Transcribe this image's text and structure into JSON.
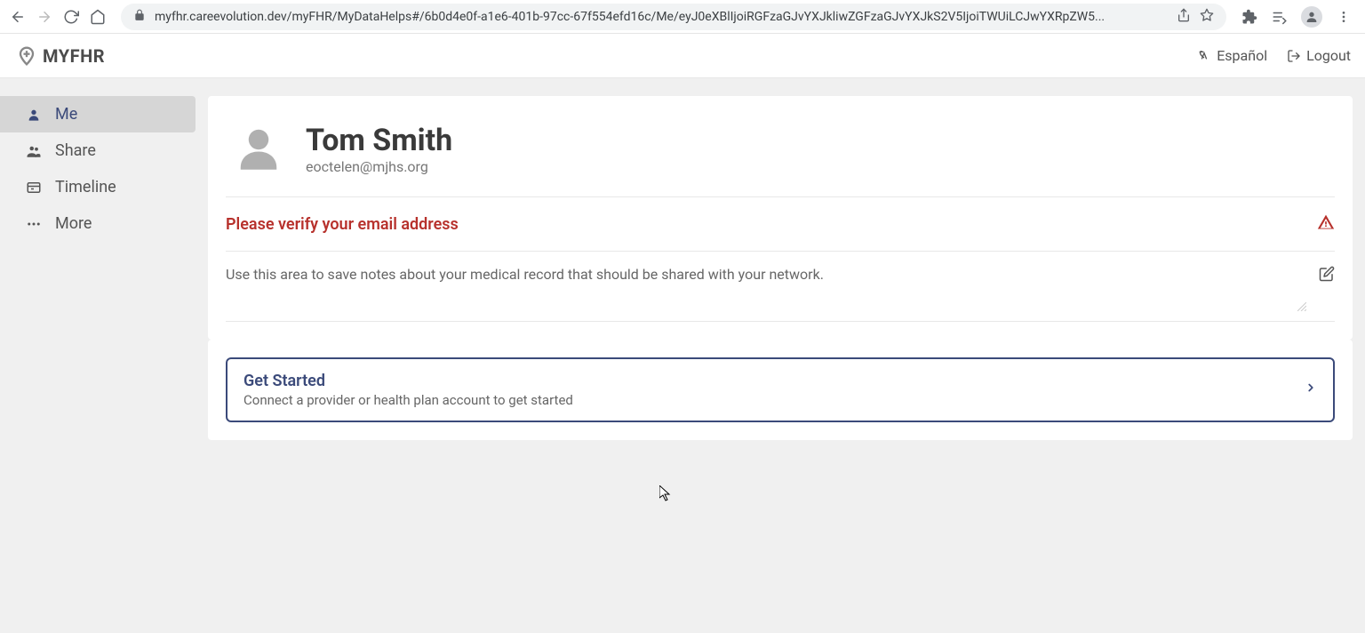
{
  "browser": {
    "url": "myfhr.careevolution.dev/myFHR/MyDataHelps#/6b0d4e0f-a1e6-401b-97cc-67f554efd16c/Me/eyJ0eXBlIjoiRGFzaGJvYXJkliwZGFzaGJvYXJkS2V5IjoiTWUiLCJwYXRpZW5..."
  },
  "logo": {
    "text": "MYFHR"
  },
  "header": {
    "language_label": "Español",
    "logout_label": "Logout"
  },
  "sidebar": {
    "items": [
      {
        "label": "Me"
      },
      {
        "label": "Share"
      },
      {
        "label": "Timeline"
      },
      {
        "label": "More"
      }
    ]
  },
  "profile": {
    "name": "Tom Smith",
    "email": "eoctelen@mjhs.org"
  },
  "alert": {
    "text": "Please verify your email address"
  },
  "notes": {
    "placeholder": "Use this area to save notes about your medical record that should be shared with your network."
  },
  "get_started": {
    "title": "Get Started",
    "subtitle": "Connect a provider or health plan account to get started"
  }
}
